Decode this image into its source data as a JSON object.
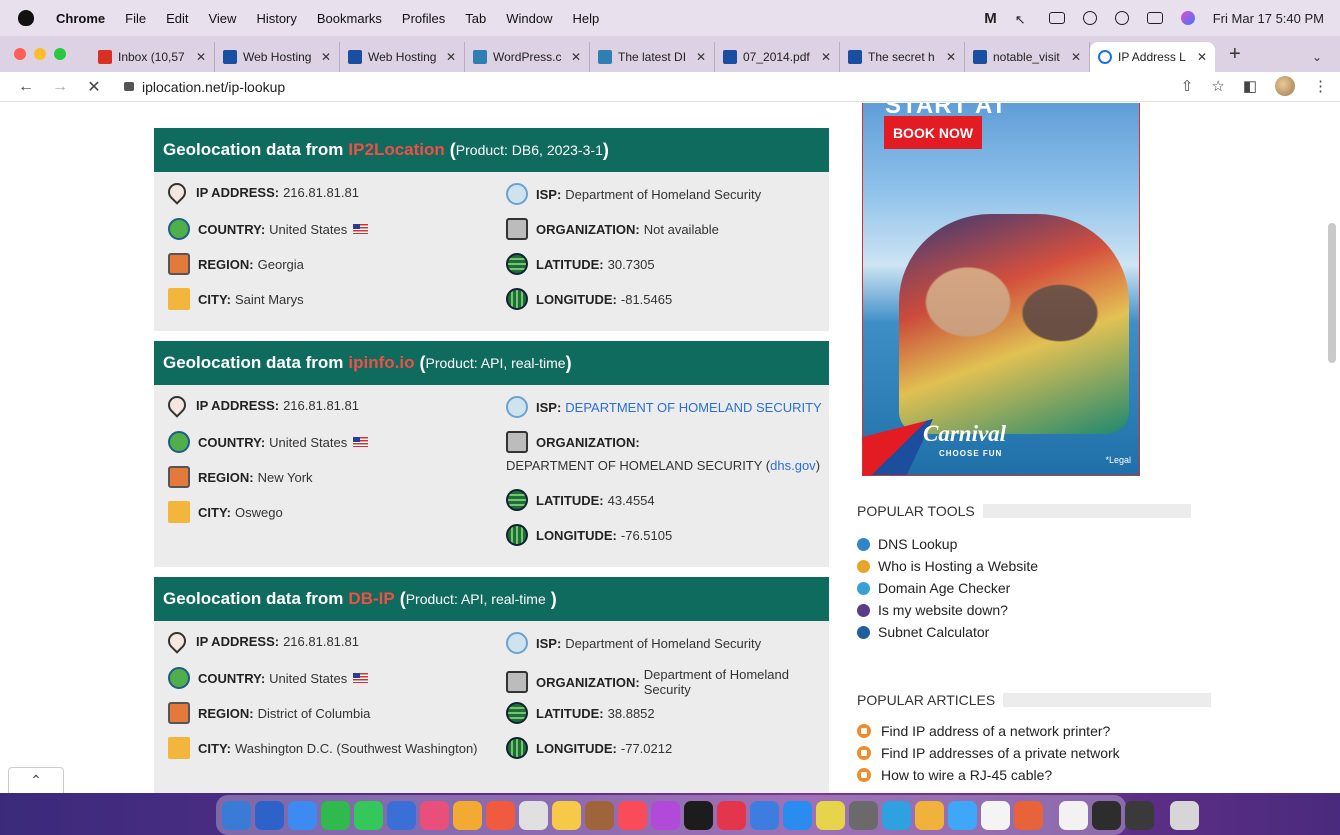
{
  "menubar": {
    "app": "Chrome",
    "items": [
      "File",
      "Edit",
      "View",
      "History",
      "Bookmarks",
      "Profiles",
      "Tab",
      "Window",
      "Help"
    ],
    "clock": "Fri Mar 17  5:40 PM"
  },
  "tabs": [
    {
      "title": "Inbox (10,57",
      "color": "#d93025"
    },
    {
      "title": "Web Hosting",
      "color": "#1a4ea0"
    },
    {
      "title": "Web Hosting",
      "color": "#1a4ea0"
    },
    {
      "title": "WordPress.c",
      "color": "#2f7fb5"
    },
    {
      "title": "The latest DI",
      "color": "#2f7fb5"
    },
    {
      "title": "07_2014.pdf",
      "color": "#1a4ea0"
    },
    {
      "title": "The secret h",
      "color": "#1a4ea0"
    },
    {
      "title": "notable_visit",
      "color": "#1a4ea0"
    },
    {
      "title": "IP Address L",
      "color": "#1a73e8",
      "active": true
    }
  ],
  "address": {
    "url": "iplocation.net/ip-lookup"
  },
  "panels": [
    {
      "title_prefix": "Geolocation data from",
      "source": "IP2Location",
      "product": "Product: DB6, 2023-3-1",
      "ip_label": "IP ADDRESS:",
      "ip": "216.81.81.81",
      "country_label": "COUNTRY:",
      "country": "United States",
      "region_label": "REGION:",
      "region": "Georgia",
      "city_label": "CITY:",
      "city": "Saint Marys",
      "isp_label": "ISP:",
      "isp": "Department of Homeland Security",
      "org_label": "ORGANIZATION:",
      "org": "Not available",
      "lat_label": "LATITUDE:",
      "lat": "30.7305",
      "lon_label": "LONGITUDE:",
      "lon": "-81.5465"
    },
    {
      "title_prefix": "Geolocation data from",
      "source": "ipinfo.io",
      "product": "Product: API, real-time",
      "ip_label": "IP ADDRESS:",
      "ip": "216.81.81.81",
      "country_label": "COUNTRY:",
      "country": "United States",
      "region_label": "REGION:",
      "region": "New York",
      "city_label": "CITY:",
      "city": "Oswego",
      "isp_label": "ISP:",
      "isp": "DEPARTMENT OF HOMELAND SECURITY",
      "org_label": "ORGANIZATION:",
      "org": "DEPARTMENT OF HOMELAND SECURITY (",
      "org_link": "dhs.gov",
      "org_close": ")",
      "lat_label": "LATITUDE:",
      "lat": "43.4554",
      "lon_label": "LONGITUDE:",
      "lon": "-76.5105"
    },
    {
      "title_prefix": "Geolocation data from",
      "source": "DB-IP",
      "product": "Product: API, real-time",
      "ip_label": "IP ADDRESS:",
      "ip": "216.81.81.81",
      "country_label": "COUNTRY:",
      "country": "United States",
      "region_label": "REGION:",
      "region": "District of Columbia",
      "city_label": "CITY:",
      "city": "Washington D.C. (Southwest Washington)",
      "isp_label": "ISP:",
      "isp": "Department of Homeland Security",
      "org_label": "ORGANIZATION:",
      "org": "Department of Homeland Security",
      "lat_label": "LATITUDE:",
      "lat": "38.8852",
      "lon_label": "LONGITUDE:",
      "lon": "-77.0212"
    }
  ],
  "ad": {
    "headline": "START AT",
    "cta": "BOOK NOW",
    "brand": "Carnival",
    "tagline": "CHOOSE FUN",
    "legal": "*Legal"
  },
  "sidebar": {
    "tools_heading": "POPULAR TOOLS",
    "tools": [
      {
        "label": "DNS Lookup",
        "color": "#2f86c6"
      },
      {
        "label": "Who is Hosting a Website",
        "color": "#e7a429"
      },
      {
        "label": "Domain Age Checker",
        "color": "#39a0d6"
      },
      {
        "label": "Is my website down?",
        "color": "#5a3d8a"
      },
      {
        "label": "Subnet Calculator",
        "color": "#1f5f9e"
      }
    ],
    "articles_heading": "POPULAR ARTICLES",
    "articles": [
      {
        "label": "Find IP address of a network printer?"
      },
      {
        "label": "Find IP addresses of a private network"
      },
      {
        "label": "How to wire a RJ-45 cable?"
      }
    ]
  },
  "dock_colors": [
    "#3a7bd5",
    "#2d63c8",
    "#3d8bf2",
    "#30b94d",
    "#34c759",
    "#3b6fd8",
    "#e94f7a",
    "#f2aa33",
    "#f05a3e",
    "#e0e0e0",
    "#f7c948",
    "#a0643a",
    "#fa4b5b",
    "#b14ad8",
    "#1c1c1c",
    "#e3354c",
    "#3e7de0",
    "#2b8cf0",
    "#e7d44a",
    "#6a6a6a",
    "#2fa0e0",
    "#f0b23a",
    "#3fa7f7",
    "#f4f4f4",
    "#e8633a",
    "#f2f2f2",
    "#2d2d2d",
    "#3a3a3a",
    "#d6d6d6"
  ]
}
